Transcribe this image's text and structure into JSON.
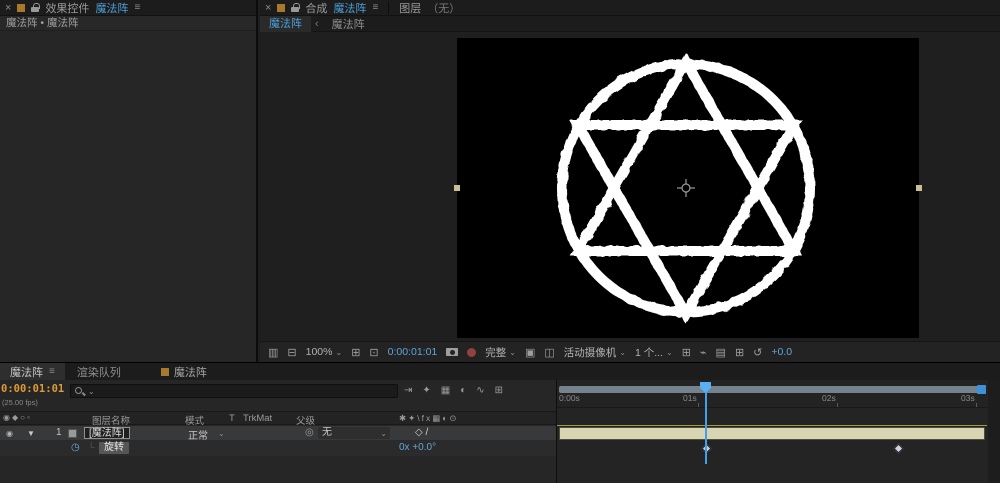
{
  "colors": {
    "accent_blue": "#4c9fd8",
    "value_blue": "#5fa7da",
    "timecode_orange": "#e09a35",
    "layer_bar": "#d9d4b2",
    "work_area_bar": "#76828e",
    "marker_line": "#9aa13c",
    "playhead_blue": "#41a0e8",
    "comp_chip_orange": "#a8792c"
  },
  "icons": {
    "menu": "≡",
    "close": "×",
    "caret": "⌄",
    "tab_sep": "‹",
    "twirl_open": "▼",
    "pickwhip": "◎",
    "grid": "⊞",
    "screen": "▥",
    "monitor": "⊟",
    "mask": "⊡",
    "roi": "▣",
    "tgrid": "◫",
    "pixel_aspect": "⊞",
    "fast_preview": "⌁",
    "timeline_btn": "▤",
    "flowchart": "⊞",
    "exposure_reset": "↺",
    "mini_flowchart": "⇥",
    "draft3d": "✦",
    "frame_blend": "▦",
    "motion_blur": "◐",
    "graph_editor": "∿",
    "stopwatch": "◷",
    "connector": "└",
    "eye": "◉",
    "av_header": "◉◆○▫",
    "switches_header": "✱✦\\fx▦◐⊙",
    "layer_switches": "◇ /"
  },
  "effect_controls": {
    "panel_title": "效果控件",
    "doc_title": "魔法阵",
    "breadcrumb": "魔法阵 • 魔法阵"
  },
  "composition": {
    "panel_title": "合成",
    "doc_title": "魔法阵",
    "layer_panel_title": "图层",
    "layer_panel_doc": "（无）",
    "viewer_tab": "魔法阵",
    "viewer_tab_other": "魔法阵",
    "toolbar": {
      "zoom": "100%",
      "timecode": "0:00:01:01",
      "resolution": "完整",
      "camera": "活动摄像机",
      "view_layout": "1 个...",
      "exposure": "+0.0"
    }
  },
  "timeline": {
    "tab_comp": "魔法阵",
    "tab_render_queue": "渲染队列",
    "tab_comp2": "魔法阵",
    "timecode": "0:00:01:01",
    "fps": "(25.00 fps)",
    "columns": {
      "layer_name": "图层名称",
      "mode": "模式",
      "t": "T",
      "trkmat": "TrkMat",
      "parent": "父级"
    },
    "layer": {
      "index": "1",
      "name": "[魔法阵]",
      "mode": "正常",
      "parent": "无"
    },
    "property": {
      "name": "旋转",
      "value": "0x +0.0°"
    },
    "ruler_labels": [
      "0:00s",
      "01s",
      "02s",
      "03s"
    ]
  }
}
